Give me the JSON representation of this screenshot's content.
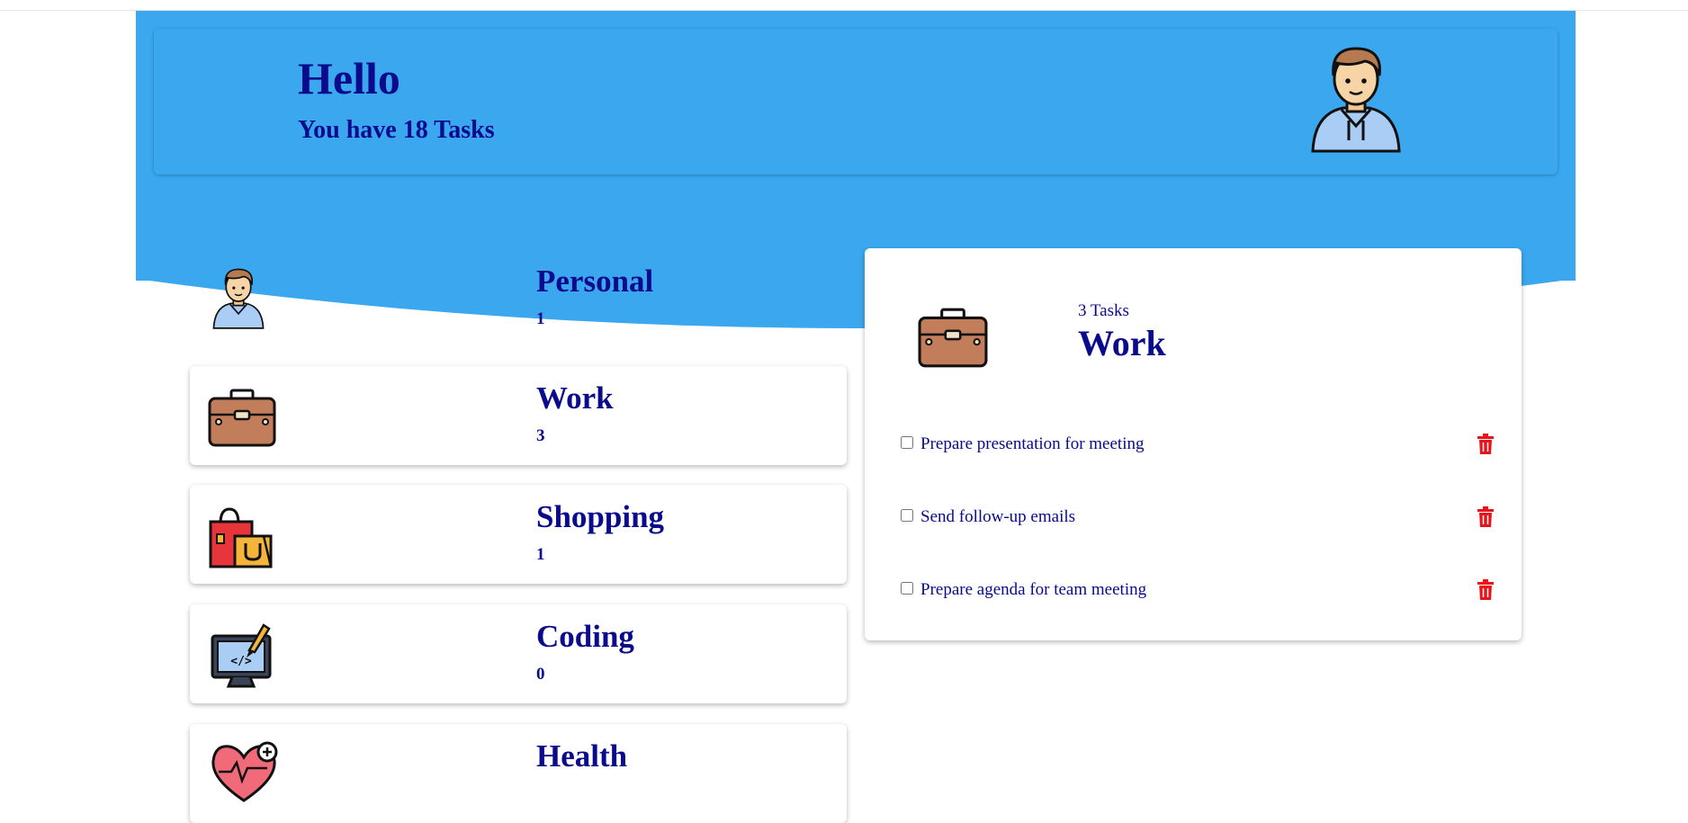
{
  "header": {
    "greeting": "Hello",
    "task_summary": "You have 18 Tasks"
  },
  "colors": {
    "hero_blue": "#3ba7ef",
    "text_navy": "#0a0a8c",
    "delete_red": "#e8141b"
  },
  "categories": [
    {
      "name": "Personal",
      "count": "1",
      "icon": "person-avatar-icon"
    },
    {
      "name": "Work",
      "count": "3",
      "icon": "briefcase-icon"
    },
    {
      "name": "Shopping",
      "count": "1",
      "icon": "shopping-bags-icon"
    },
    {
      "name": "Coding",
      "count": "0",
      "icon": "monitor-code-icon"
    },
    {
      "name": "Health",
      "count": "",
      "icon": "heart-health-icon"
    }
  ],
  "detail": {
    "subtitle": "3 Tasks",
    "title": "Work",
    "icon": "briefcase-icon",
    "tasks": [
      {
        "label": "Prepare presentation for meeting",
        "done": false
      },
      {
        "label": "Send follow-up emails",
        "done": false
      },
      {
        "label": "Prepare agenda for team meeting",
        "done": false
      }
    ]
  }
}
